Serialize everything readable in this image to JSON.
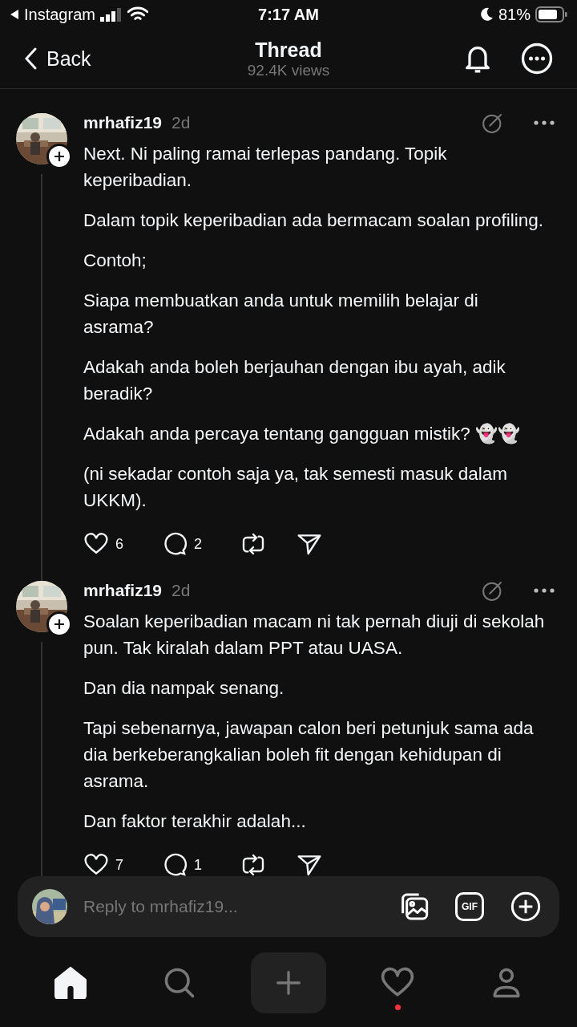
{
  "status_bar": {
    "app": "Instagram",
    "time": "7:17 AM",
    "battery": "81%"
  },
  "header": {
    "back": "Back",
    "title": "Thread",
    "views": "92.4K views"
  },
  "posts": [
    {
      "username": "mrhafiz19",
      "time": "2d",
      "paragraphs": [
        "Next. Ni paling ramai terlepas pandang. Topik keperibadian.",
        "Dalam topik keperibadian ada bermacam soalan profiling.",
        "Contoh;",
        "Siapa membuatkan anda untuk memilih belajar di asrama?",
        "Adakah anda boleh berjauhan dengan ibu ayah, adik beradik?",
        "Adakah anda percaya tentang gangguan mistik? 👻👻",
        "(ni sekadar contoh saja ya, tak semesti masuk dalam UKKM)."
      ],
      "likes": "6",
      "replies": "2"
    },
    {
      "username": "mrhafiz19",
      "time": "2d",
      "paragraphs": [
        "Soalan keperibadian macam ni tak pernah diuji di sekolah pun. Tak kiralah dalam PPT atau UASA.",
        "Dan dia nampak senang.",
        "Tapi sebenarnya, jawapan calon beri petunjuk sama ada dia berkeberangkalian boleh fit dengan kehidupan di asrama.",
        "Dan faktor terakhir adalah..."
      ],
      "likes": "7",
      "replies": "1"
    }
  ],
  "reply_bar": {
    "placeholder": "Reply to mrhafiz19...",
    "gif_label": "GIF"
  },
  "nav": [
    {
      "kind": "home",
      "selected": true,
      "badge": false
    },
    {
      "kind": "search",
      "selected": false,
      "badge": false
    },
    {
      "kind": "create",
      "selected": false,
      "badge": false
    },
    {
      "kind": "activity",
      "selected": false,
      "badge": true
    },
    {
      "kind": "profile",
      "selected": false,
      "badge": false
    }
  ]
}
